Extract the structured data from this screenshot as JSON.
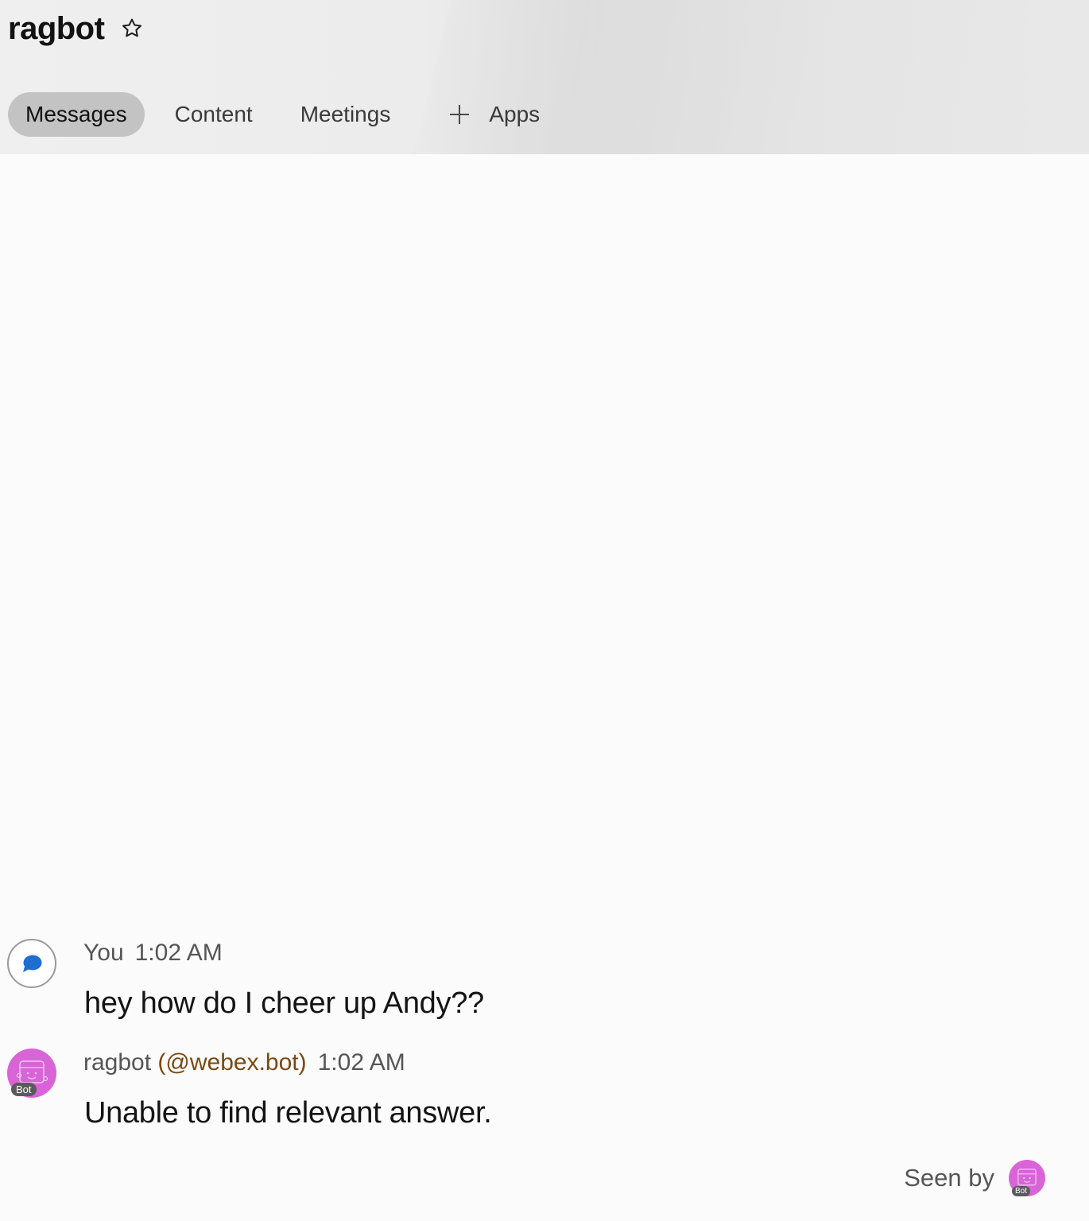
{
  "header": {
    "title": "ragbot",
    "star_icon": "star-outline-icon",
    "tabs": [
      {
        "label": "Messages",
        "active": true
      },
      {
        "label": "Content",
        "active": false
      },
      {
        "label": "Meetings",
        "active": false
      }
    ],
    "apps_label": "Apps",
    "apps_icon": "plus-icon"
  },
  "messages": [
    {
      "sender": "You",
      "handle": "",
      "time": "1:02 AM",
      "text": "hey how do I cheer up Andy??",
      "avatar_icon": "chat-bubble-icon"
    },
    {
      "sender": "ragbot",
      "handle": "(@webex.bot)",
      "time": "1:02 AM",
      "text": "Unable to find relevant answer.",
      "avatar_icon": "bot-face-icon",
      "badge": "Bot"
    }
  ],
  "seen": {
    "label": "Seen by",
    "badge": "Bot"
  },
  "colors": {
    "bot_avatar": "#d864d8",
    "active_tab": "#c3c3c3",
    "handle": "#7a4a12",
    "you_bubble": "#1f6fd0"
  }
}
